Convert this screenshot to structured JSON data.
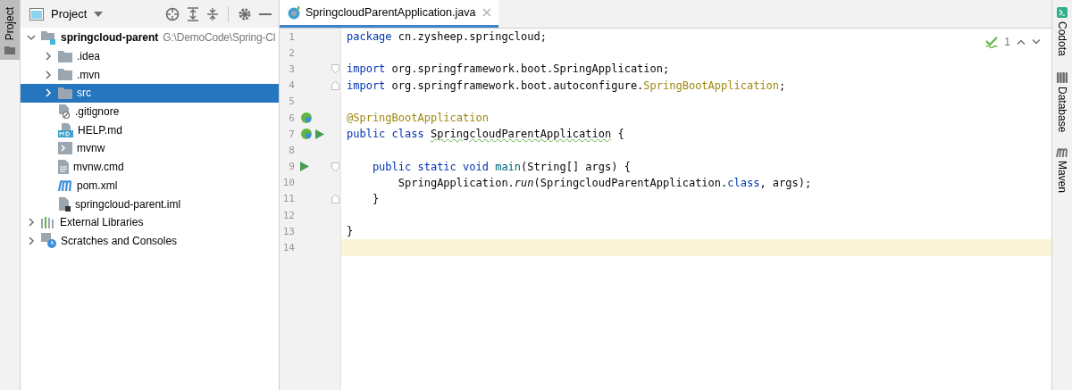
{
  "left_strip": {
    "tabs": [
      {
        "label": "Project",
        "selected": true
      }
    ]
  },
  "project_panel": {
    "title": "Project",
    "tree": [
      {
        "label": "springcloud-parent",
        "path": "G:\\DemoCode\\Spring-Cl",
        "kind": "module",
        "expanded": true,
        "selected": false,
        "children": [
          {
            "label": ".idea",
            "kind": "folder",
            "expanded": false,
            "selected": false
          },
          {
            "label": ".mvn",
            "kind": "folder",
            "expanded": false,
            "selected": false
          },
          {
            "label": "src",
            "kind": "folder",
            "expanded": false,
            "selected": true
          },
          {
            "label": ".gitignore",
            "kind": "ignored",
            "selected": false
          },
          {
            "label": "HELP.md",
            "kind": "markdown",
            "selected": false
          },
          {
            "label": "mvnw",
            "kind": "shell",
            "selected": false
          },
          {
            "label": "mvnw.cmd",
            "kind": "text",
            "selected": false
          },
          {
            "label": "pom.xml",
            "kind": "maven",
            "selected": false
          },
          {
            "label": "springcloud-parent.iml",
            "kind": "iml",
            "selected": false
          }
        ]
      },
      {
        "label": "External Libraries",
        "kind": "libraries",
        "expanded": false,
        "selected": false
      },
      {
        "label": "Scratches and Consoles",
        "kind": "scratches",
        "expanded": false,
        "selected": false
      }
    ]
  },
  "editor": {
    "tabs": [
      {
        "label": "SpringcloudParentApplication.java",
        "selected": true
      }
    ],
    "inspection_count": "1",
    "lines": [
      {
        "number": "1",
        "kind": "plain",
        "current": false,
        "tokens": [
          {
            "kind": "kw",
            "text": "package"
          },
          {
            "kind": "plain",
            "text": " cn.zysheep.springcloud;"
          }
        ]
      },
      {
        "number": "2",
        "kind": "plain",
        "current": false
      },
      {
        "number": "3",
        "kind": "fold_start",
        "current": false,
        "tokens": [
          {
            "kind": "kw",
            "text": "import"
          },
          {
            "kind": "plain",
            "text": " org.springframework.boot.SpringApplication;"
          }
        ]
      },
      {
        "number": "4",
        "kind": "fold_end",
        "current": false,
        "tokens": [
          {
            "kind": "kw",
            "text": "import"
          },
          {
            "kind": "plain",
            "text": " org.springframework.boot.autoconfigure."
          },
          {
            "kind": "ann",
            "text": "SpringBootApplication"
          },
          {
            "kind": "plain",
            "text": ";"
          }
        ]
      },
      {
        "number": "5",
        "kind": "plain",
        "current": false
      },
      {
        "number": "6",
        "kind": "bean",
        "current": false,
        "tokens": [
          {
            "kind": "ann",
            "text": "@SpringBootApplication"
          }
        ]
      },
      {
        "number": "7",
        "kind": "bean_run",
        "current": false,
        "tokens": [
          {
            "kind": "kw",
            "text": "public class "
          },
          {
            "kind": "typo",
            "text": "SpringcloudParentApplication"
          },
          {
            "kind": "plain",
            "text": " {"
          }
        ]
      },
      {
        "number": "8",
        "kind": "plain",
        "current": false
      },
      {
        "number": "9",
        "kind": "run_fold_start",
        "current": false,
        "tokens": [
          {
            "kind": "kw",
            "text": "    public static void "
          },
          {
            "kind": "method",
            "text": "main"
          },
          {
            "kind": "plain",
            "text": "(String[] args) {"
          }
        ]
      },
      {
        "number": "10",
        "kind": "plain",
        "current": false,
        "tokens": [
          {
            "kind": "plain",
            "text": "        SpringApplication."
          },
          {
            "kind": "italic",
            "text": "run"
          },
          {
            "kind": "plain",
            "text": "(SpringcloudParentApplication."
          },
          {
            "kind": "kw",
            "text": "class"
          },
          {
            "kind": "plain",
            "text": ", args);"
          }
        ]
      },
      {
        "number": "11",
        "kind": "fold_end",
        "current": false,
        "tokens": [
          {
            "kind": "plain",
            "text": "    }"
          }
        ]
      },
      {
        "number": "12",
        "kind": "plain",
        "current": false
      },
      {
        "number": "13",
        "kind": "plain",
        "current": false,
        "tokens": [
          {
            "kind": "plain",
            "text": "}"
          }
        ]
      },
      {
        "number": "14",
        "kind": "plain",
        "current": true
      }
    ]
  },
  "right_strip": {
    "tabs": [
      {
        "label": "Codota",
        "kind": "codota"
      },
      {
        "label": "Database",
        "kind": "database"
      },
      {
        "label": "Maven",
        "kind": "maven"
      }
    ]
  }
}
